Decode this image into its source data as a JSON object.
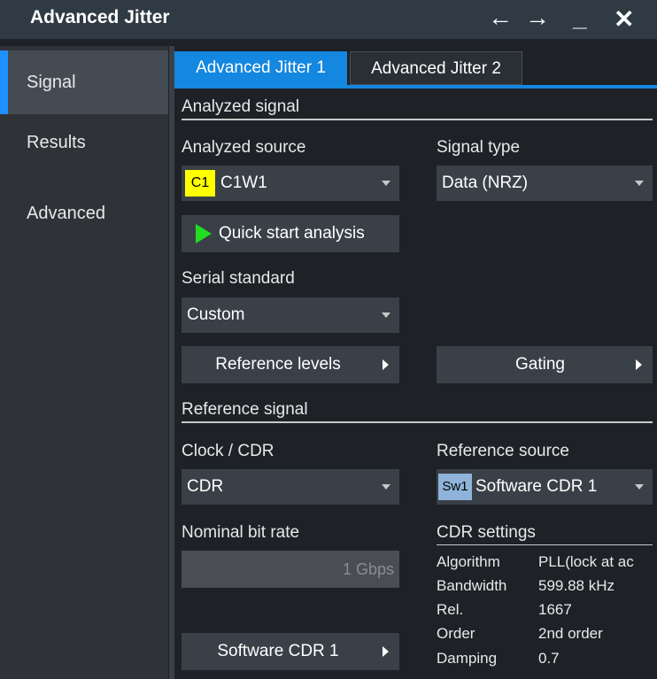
{
  "window": {
    "title": "Advanced Jitter"
  },
  "titlebar_icons": {
    "back": "←",
    "forward": "→",
    "minimize": "_",
    "close": "✕"
  },
  "sidebar": {
    "items": [
      {
        "label": "Signal"
      },
      {
        "label": "Results"
      },
      {
        "label": "Advanced"
      }
    ]
  },
  "tabs": [
    {
      "label": "Advanced Jitter 1"
    },
    {
      "label": "Advanced Jitter 2"
    }
  ],
  "analyzed_signal": {
    "heading": "Analyzed signal",
    "source_label": "Analyzed source",
    "source_badge": "C1",
    "source_value": "C1W1",
    "type_label": "Signal type",
    "type_value": "Data (NRZ)",
    "quick_start": "Quick start analysis",
    "serial_label": "Serial standard",
    "serial_value": "Custom",
    "ref_levels": "Reference levels",
    "gating": "Gating"
  },
  "reference_signal": {
    "heading": "Reference signal",
    "clock_label": "Clock / CDR",
    "clock_value": "CDR",
    "ref_source_label": "Reference source",
    "ref_source_badge": "Sw1",
    "ref_source_value": "Software CDR 1",
    "bitrate_label": "Nominal bit rate",
    "bitrate_value": "1 Gbps",
    "cdr_settings_label": "CDR settings",
    "software_cdr_button": "Software CDR 1",
    "cdr_settings": [
      {
        "key": "Algorithm",
        "value": "PLL(lock at ac"
      },
      {
        "key": "Bandwidth",
        "value": "599.88 kHz"
      },
      {
        "key": "Rel.",
        "value": "1667"
      },
      {
        "key": "Order",
        "value": "2nd order"
      },
      {
        "key": "Damping",
        "value": "0.7"
      }
    ]
  },
  "colors": {
    "accent": "#1487e0",
    "c1_badge": "#ffff00",
    "sw1_badge": "#8fb3d9",
    "play": "#22dd22"
  }
}
